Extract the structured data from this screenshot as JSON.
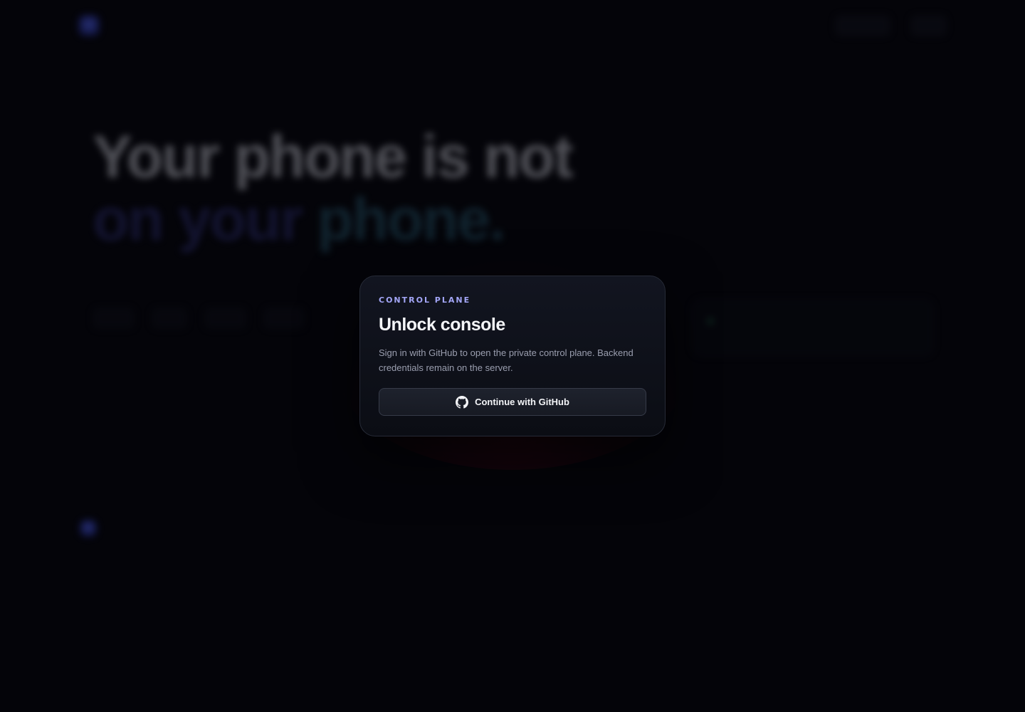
{
  "modal": {
    "eyebrow": "CONTROL PLANE",
    "title": "Unlock console",
    "description": "Sign in with GitHub to open the private control plane. Backend credentials remain on the server.",
    "github_button_label": "Continue with GitHub",
    "github_icon": "github-icon"
  },
  "colors": {
    "page_background": "#040409",
    "modal_background": "#121520",
    "eyebrow": "#a3a6f7",
    "title": "#f4f5f8",
    "description": "#9a9eaf",
    "button_border": "#363b48"
  },
  "backdrop": {
    "hero_headline_line1": "Your phone is not",
    "hero_headline_line2": "on your",
    "hero_headline_accent": "phone."
  }
}
